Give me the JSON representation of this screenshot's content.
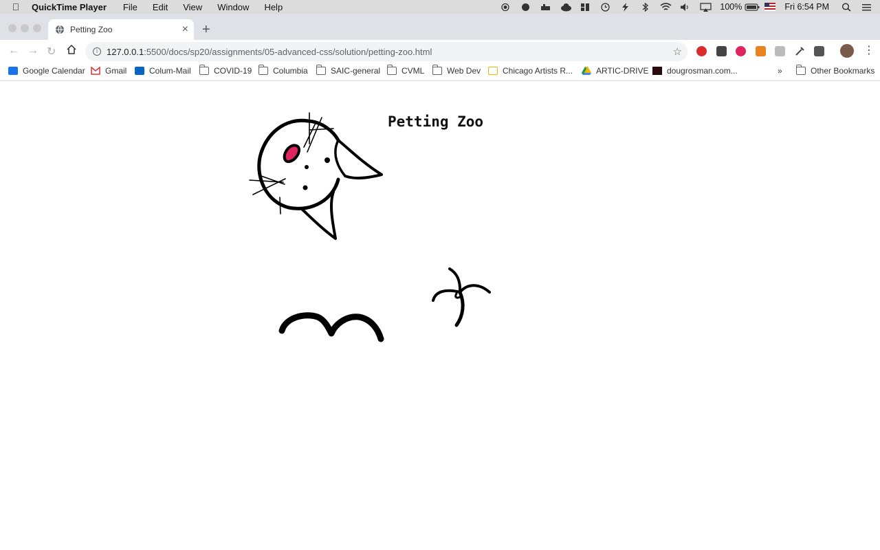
{
  "menubar": {
    "app_name": "QuickTime Player",
    "items": [
      "File",
      "Edit",
      "View",
      "Window",
      "Help"
    ],
    "battery": "100%",
    "clock": "Fri 6:54 PM"
  },
  "browser": {
    "tab_title": "Petting Zoo",
    "url_host": "127.0.0.1",
    "url_path": ":5500/docs/sp20/assignments/05-advanced-css/solution/petting-zoo.html"
  },
  "bookmarks": {
    "items": [
      "Google Calendar",
      "Gmail",
      "Colum-Mail",
      "COVID-19",
      "Columbia",
      "SAIC-general",
      "CVML",
      "Web Dev",
      "Chicago Artists R...",
      "ARTIC-DRIVE",
      "dougrosman.com..."
    ],
    "overflow": "»",
    "other": "Other Bookmarks"
  },
  "page": {
    "title": "Petting Zoo"
  },
  "colors": {
    "menubar_bg": "#dcdcdc",
    "tabstrip_bg": "#dee1e6",
    "cat_ear_pink": "#e0245e"
  }
}
